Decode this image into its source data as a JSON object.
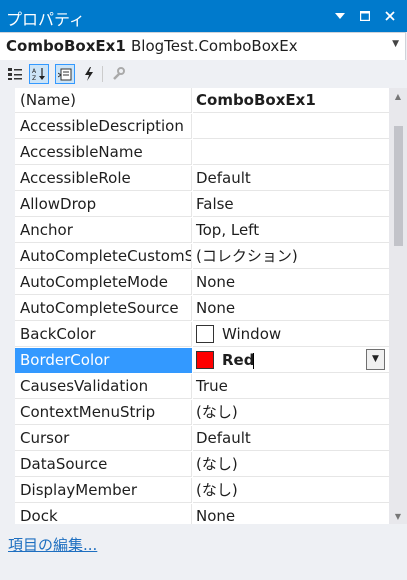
{
  "window": {
    "title": "プロパティ",
    "buttons": [
      "dropdown",
      "maximize",
      "close"
    ]
  },
  "object_selector": {
    "name": "ComboBoxEx1",
    "type": "BlogTest.ComboBoxEx"
  },
  "toolbar": {
    "tools": [
      {
        "icon": "categorized-icon",
        "active": false
      },
      {
        "icon": "alphabetical-icon",
        "active": true
      },
      {
        "icon": "properties-icon",
        "active": true
      },
      {
        "icon": "events-icon",
        "active": false
      },
      {
        "icon": "property-pages-icon",
        "active": false
      }
    ]
  },
  "properties": [
    {
      "name": "(Name)",
      "value": "ComboBoxEx1",
      "bold": true
    },
    {
      "name": "AccessibleDescription",
      "value": ""
    },
    {
      "name": "AccessibleName",
      "value": ""
    },
    {
      "name": "AccessibleRole",
      "value": "Default"
    },
    {
      "name": "AllowDrop",
      "value": "False"
    },
    {
      "name": "Anchor",
      "value": "Top, Left"
    },
    {
      "name": "AutoCompleteCustomSource",
      "value": "(コレクション)"
    },
    {
      "name": "AutoCompleteMode",
      "value": "None"
    },
    {
      "name": "AutoCompleteSource",
      "value": "None"
    },
    {
      "name": "BackColor",
      "value": "Window",
      "swatch": "#ffffff"
    },
    {
      "name": "BorderColor",
      "value": "Red",
      "swatch": "#ff0000",
      "selected": true
    },
    {
      "name": "CausesValidation",
      "value": "True"
    },
    {
      "name": "ContextMenuStrip",
      "value": "(なし)"
    },
    {
      "name": "Cursor",
      "value": "Default"
    },
    {
      "name": "DataSource",
      "value": "(なし)"
    },
    {
      "name": "DisplayMember",
      "value": "(なし)"
    },
    {
      "name": "Dock",
      "value": "None"
    }
  ],
  "footer": {
    "link": "項目の編集..."
  },
  "colors": {
    "titlebar": "#007acc",
    "selection": "#3399ff",
    "link": "#1e6fc0"
  }
}
